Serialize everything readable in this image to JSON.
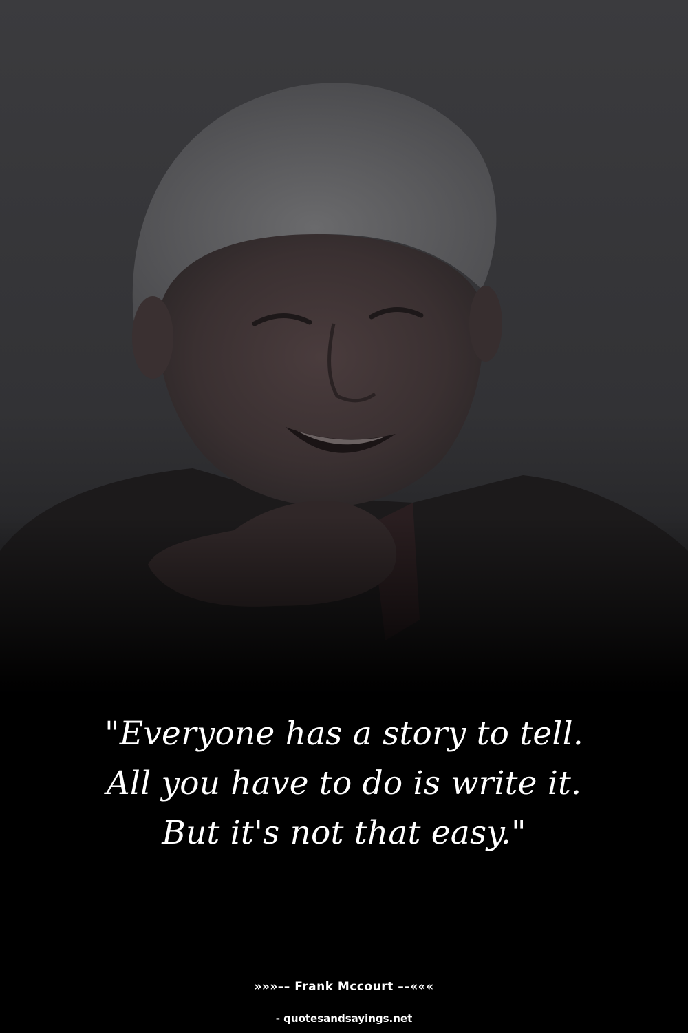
{
  "quote": {
    "text": "\"Everyone has a story to tell. All you have to do is write it. But it's not that easy.\""
  },
  "author": {
    "line": "»»»–– Frank Mccourt ––«««"
  },
  "source": {
    "line": "- quotesandsayings.net"
  },
  "colors": {
    "background": "#000000",
    "photo_backdrop": "#3b3b3e",
    "text": "#ffffff"
  }
}
